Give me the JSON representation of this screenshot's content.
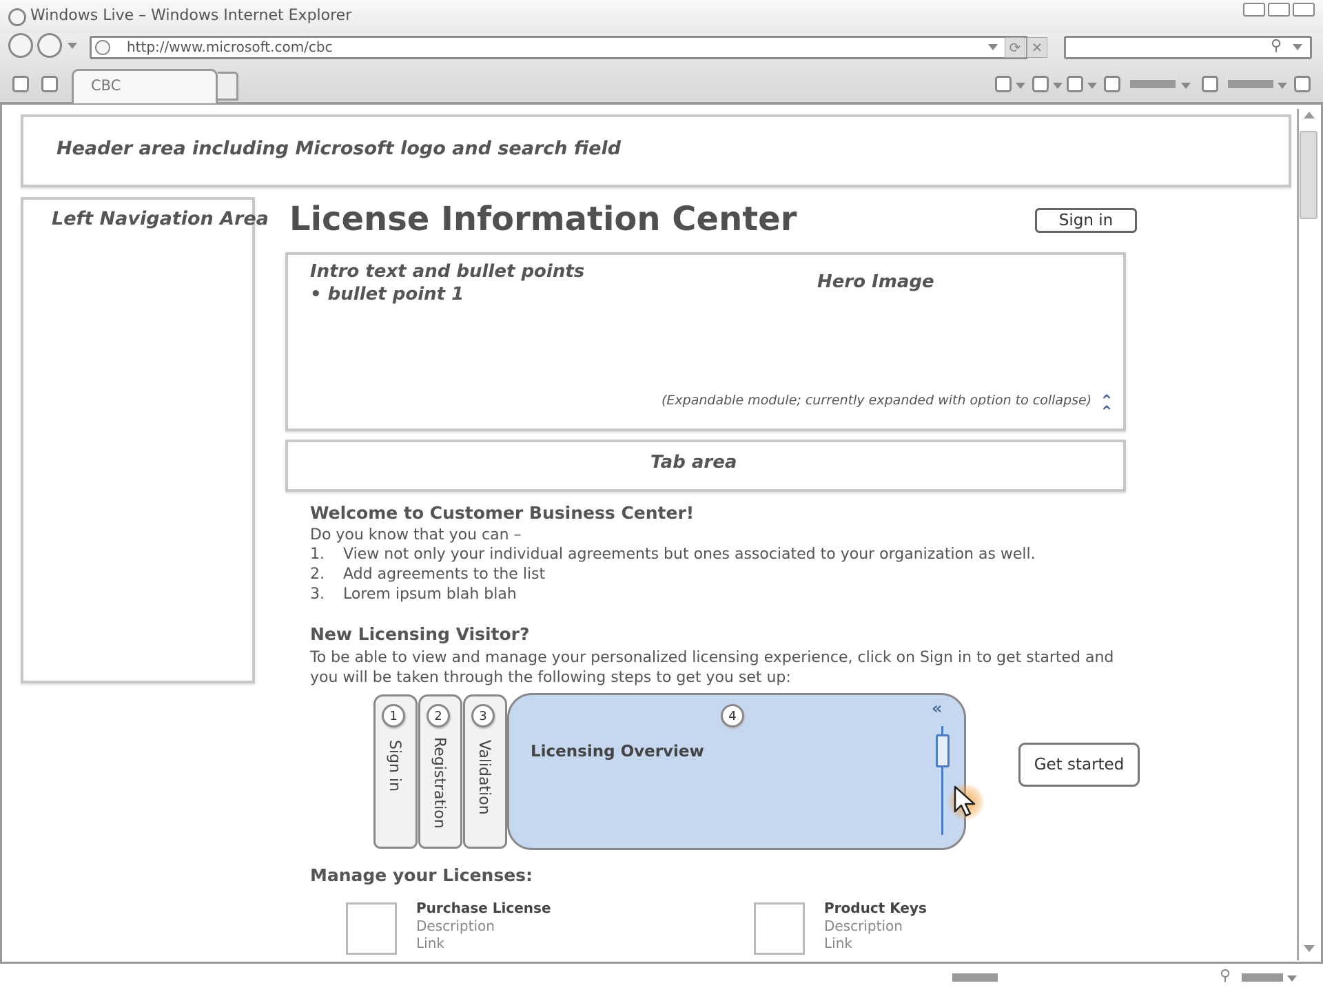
{
  "window": {
    "title": "Windows Live – Windows Internet Explorer"
  },
  "address_bar": {
    "url": "http://www.microsoft.com/cbc"
  },
  "tabs": [
    {
      "label": "CBC"
    }
  ],
  "page": {
    "header_note": "Header area including Microsoft logo and search field",
    "left_nav_note": "Left Navigation Area",
    "title": "License Information Center",
    "sign_in_label": "Sign in",
    "intro": {
      "line1": "Intro text and bullet points",
      "line2": "• bullet point 1",
      "hero_note": "Hero Image",
      "expand_note": "(Expandable module; currently expanded with option to collapse)"
    },
    "tab_area_note": "Tab area",
    "welcome": {
      "heading": "Welcome to Customer Business Center!",
      "intro": "Do you know that you can –",
      "items": [
        {
          "num": "1.",
          "text": "View not only your individual agreements but ones associated to your organization as well."
        },
        {
          "num": "2.",
          "text": "Add agreements to the list"
        },
        {
          "num": "3.",
          "text": "Lorem ipsum blah blah"
        }
      ]
    },
    "visitor": {
      "heading": "New Licensing Visitor?",
      "text": "To be able to view and manage your personalized licensing experience, click on Sign in to get started and you will be taken through the following steps to get you set up:"
    },
    "steps": [
      {
        "num": "1",
        "label": "Sign in"
      },
      {
        "num": "2",
        "label": "Registration"
      },
      {
        "num": "3",
        "label": "Validation"
      },
      {
        "num": "4",
        "label": "Licensing Overview"
      }
    ],
    "get_started_label": "Get started",
    "manage": {
      "heading": "Manage your Licenses:",
      "cards": [
        {
          "title": "Purchase License",
          "description": "Description",
          "link": "Link"
        },
        {
          "title": "Product Keys",
          "description": "Description",
          "link": "Link"
        }
      ]
    }
  },
  "icons": {
    "back": "back-icon",
    "forward": "forward-icon",
    "refresh": "refresh-icon",
    "stop": "stop-icon",
    "search": "search-icon",
    "collapse": "double-chevron-up-icon",
    "step_collapse": "double-chevron-left-icon",
    "cursor": "mouse-cursor-icon"
  },
  "colors": {
    "active_step": "#c6d8f0",
    "slider": "#4a7bc8",
    "cursor_highlight": "#f0a03c"
  }
}
